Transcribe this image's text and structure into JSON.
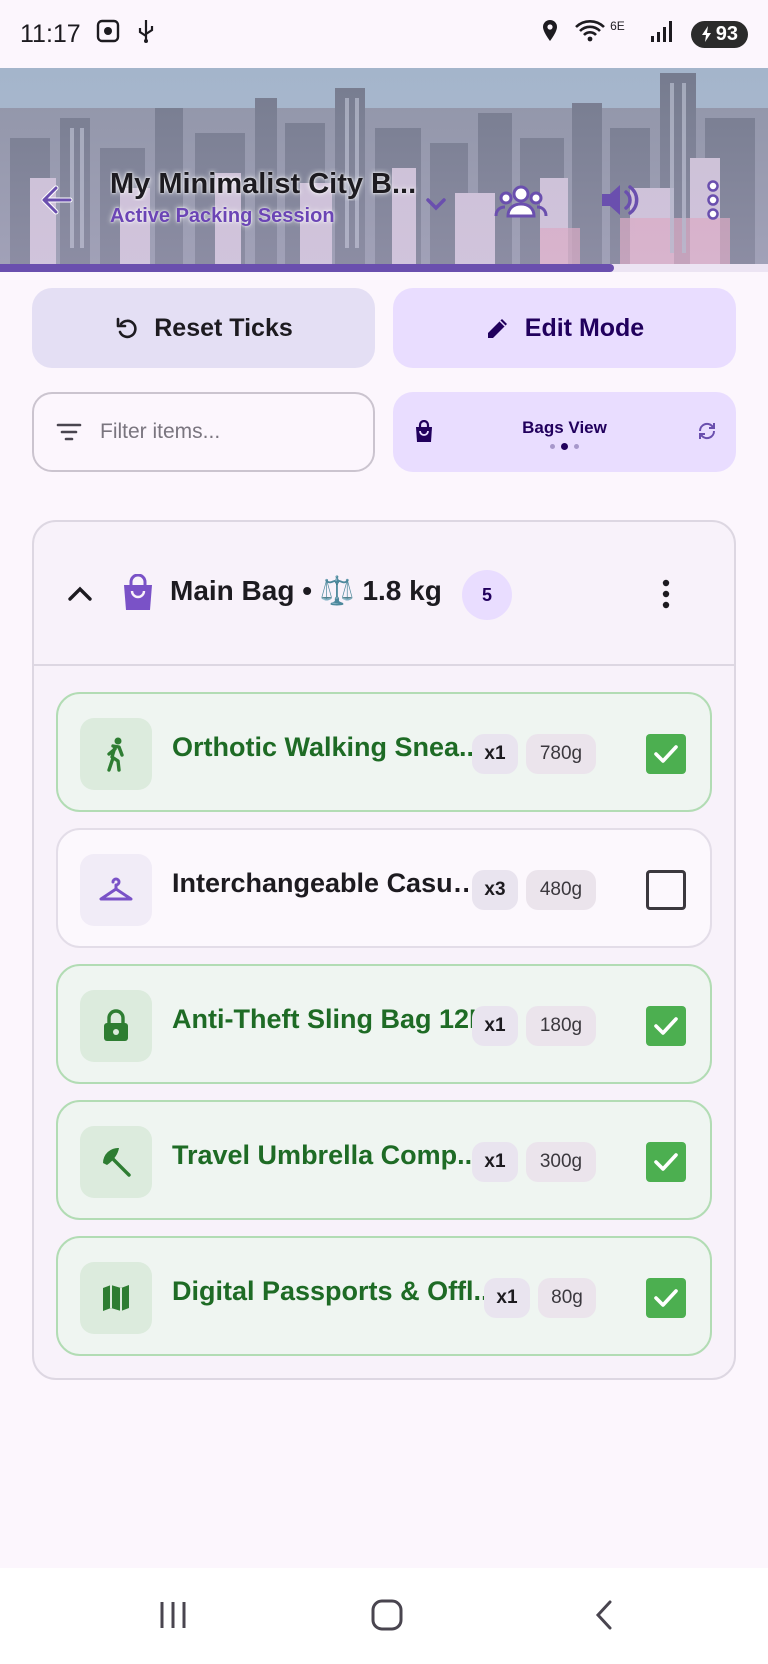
{
  "status_bar": {
    "time": "11:17",
    "network": "6E",
    "battery": "93",
    "icons": [
      "screenshot-icon",
      "usb-icon",
      "location-icon",
      "wifi-icon",
      "signal-icon",
      "battery-icon"
    ]
  },
  "header": {
    "title": "My Minimalist City B...",
    "subtitle": "Active Packing Session",
    "progress": 0.8
  },
  "actions": {
    "reset_label": "Reset Ticks",
    "edit_label": "Edit Mode"
  },
  "filter": {
    "placeholder": "Filter items...",
    "value": ""
  },
  "view_toggle": {
    "label": "Bags View",
    "active_index": 1,
    "count": 3
  },
  "bag": {
    "name": "Main Bag • ⚖️ 1.8 kg",
    "count": "5",
    "items": [
      {
        "name": "Orthotic Walking Snea...",
        "qty": "x1",
        "weight": "780g",
        "packed": true,
        "icon": "walking-icon"
      },
      {
        "name": "Interchangeable Casua...",
        "qty": "x3",
        "weight": "480g",
        "packed": false,
        "icon": "hanger-icon"
      },
      {
        "name": "Anti-Theft Sling Bag 12L",
        "qty": "x1",
        "weight": "180g",
        "packed": true,
        "icon": "lock-icon"
      },
      {
        "name": "Travel Umbrella Comp...",
        "qty": "x1",
        "weight": "300g",
        "packed": true,
        "icon": "umbrella-icon"
      },
      {
        "name": "Digital Passports & Offl...",
        "qty": "x1",
        "weight": "80g",
        "packed": true,
        "icon": "map-icon"
      }
    ]
  },
  "colors": {
    "accent": "#6a4fae",
    "packed_text": "#1e6b25",
    "checkbox_on": "#4caf50"
  }
}
